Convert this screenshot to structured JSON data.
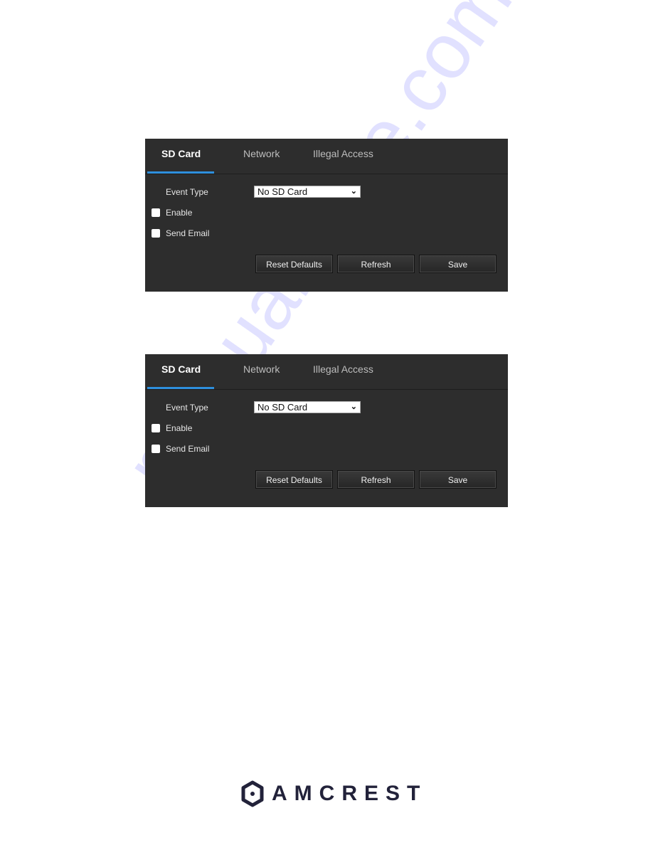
{
  "panels": [
    {
      "tabs": [
        {
          "label": "SD Card",
          "active": true
        },
        {
          "label": "Network",
          "active": false
        },
        {
          "label": "Illegal Access",
          "active": false
        }
      ],
      "event_type_label": "Event Type",
      "event_type_value": "No SD Card",
      "enable_label": "Enable",
      "enable_checked": false,
      "send_email_label": "Send Email",
      "send_email_checked": false,
      "buttons": {
        "reset": "Reset Defaults",
        "refresh": "Refresh",
        "save": "Save"
      }
    },
    {
      "tabs": [
        {
          "label": "SD Card",
          "active": true
        },
        {
          "label": "Network",
          "active": false
        },
        {
          "label": "Illegal Access",
          "active": false
        }
      ],
      "event_type_label": "Event Type",
      "event_type_value": "No SD Card",
      "enable_label": "Enable",
      "enable_checked": false,
      "send_email_label": "Send Email",
      "send_email_checked": false,
      "buttons": {
        "reset": "Reset Defaults",
        "refresh": "Refresh",
        "save": "Save"
      }
    }
  ],
  "watermark": "manualshive.com",
  "footer": {
    "brand": "AMCREST"
  },
  "colors": {
    "panel_bg": "#2d2d2d",
    "accent": "#2e8fdd",
    "brand": "#22223a"
  }
}
